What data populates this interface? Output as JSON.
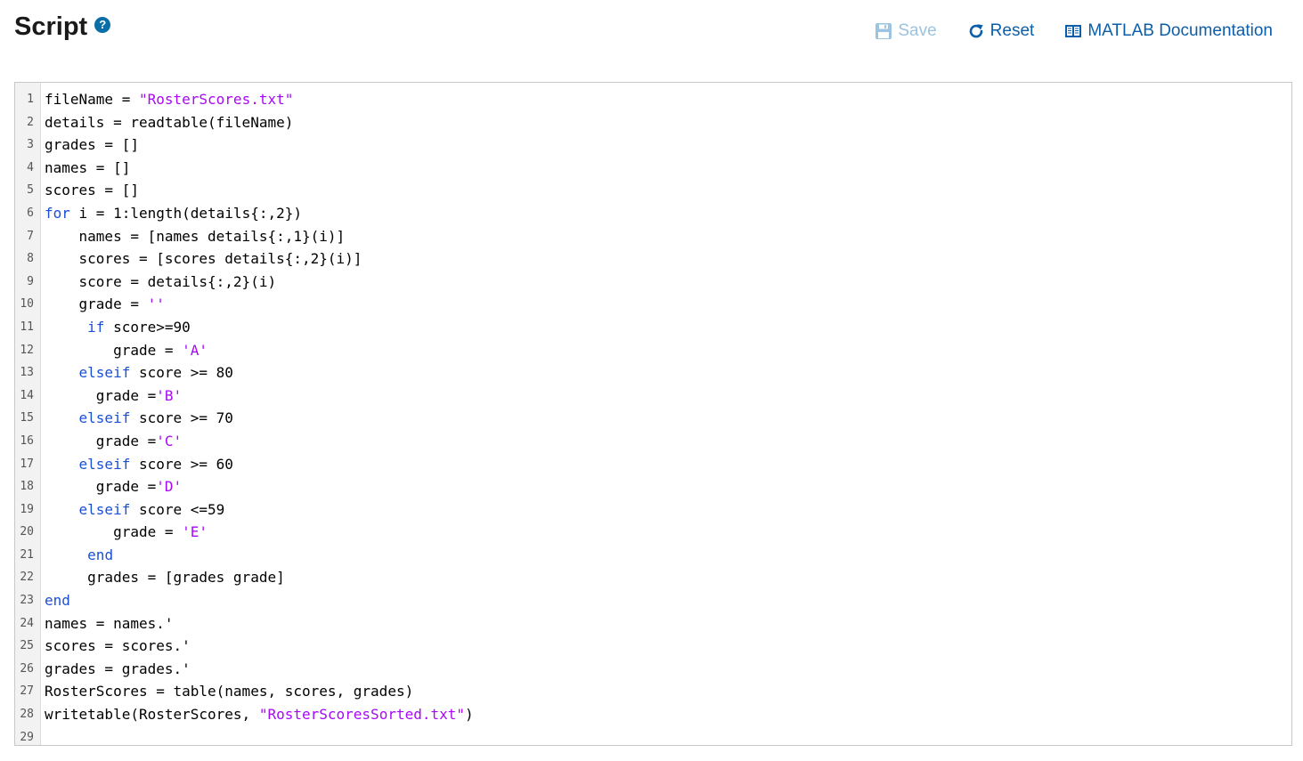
{
  "header": {
    "title": "Script",
    "help_icon": "question-circle-icon"
  },
  "toolbar": {
    "save_label": "Save",
    "reset_label": "Reset",
    "docs_label": "MATLAB Documentation"
  },
  "colors": {
    "accent": "#0b5ea8",
    "keyword": "#1a4fd6",
    "string": "#a709f5"
  },
  "editor": {
    "lines": [
      [
        {
          "t": "fileName = "
        },
        {
          "t": "\"RosterScores.txt\"",
          "c": "str"
        }
      ],
      [
        {
          "t": "details = readtable(fileName)"
        }
      ],
      [
        {
          "t": "grades = []"
        }
      ],
      [
        {
          "t": "names = []"
        }
      ],
      [
        {
          "t": "scores = []"
        }
      ],
      [
        {
          "t": "for",
          "c": "kw"
        },
        {
          "t": " i = 1:length(details{:,2})"
        }
      ],
      [
        {
          "t": "    names = [names details{:,1}(i)]"
        }
      ],
      [
        {
          "t": "    scores = [scores details{:,2}(i)]"
        }
      ],
      [
        {
          "t": "    score = details{:,2}(i)"
        }
      ],
      [
        {
          "t": "    grade = "
        },
        {
          "t": "''",
          "c": "str"
        }
      ],
      [
        {
          "t": "     "
        },
        {
          "t": "if",
          "c": "kw"
        },
        {
          "t": " score>=90"
        }
      ],
      [
        {
          "t": "        grade = "
        },
        {
          "t": "'A'",
          "c": "str"
        }
      ],
      [
        {
          "t": "    "
        },
        {
          "t": "elseif",
          "c": "kw"
        },
        {
          "t": " score >= 80"
        }
      ],
      [
        {
          "t": "      grade ="
        },
        {
          "t": "'B'",
          "c": "str"
        }
      ],
      [
        {
          "t": "    "
        },
        {
          "t": "elseif",
          "c": "kw"
        },
        {
          "t": " score >= 70"
        }
      ],
      [
        {
          "t": "      grade ="
        },
        {
          "t": "'C'",
          "c": "str"
        }
      ],
      [
        {
          "t": "    "
        },
        {
          "t": "elseif",
          "c": "kw"
        },
        {
          "t": " score >= 60"
        }
      ],
      [
        {
          "t": "      grade ="
        },
        {
          "t": "'D'",
          "c": "str"
        }
      ],
      [
        {
          "t": "    "
        },
        {
          "t": "elseif",
          "c": "kw"
        },
        {
          "t": " score <=59"
        }
      ],
      [
        {
          "t": "        grade = "
        },
        {
          "t": "'E'",
          "c": "str"
        }
      ],
      [
        {
          "t": "     "
        },
        {
          "t": "end",
          "c": "kw"
        }
      ],
      [
        {
          "t": "     grades = [grades grade]"
        }
      ],
      [
        {
          "t": "end",
          "c": "kw"
        }
      ],
      [
        {
          "t": "names = names.'"
        }
      ],
      [
        {
          "t": "scores = scores.'"
        }
      ],
      [
        {
          "t": "grades = grades.'"
        }
      ],
      [
        {
          "t": "RosterScores = table(names, scores, grades)"
        }
      ],
      [
        {
          "t": "writetable(RosterScores, "
        },
        {
          "t": "\"RosterScoresSorted.txt\"",
          "c": "str"
        },
        {
          "t": ")"
        }
      ],
      []
    ]
  }
}
